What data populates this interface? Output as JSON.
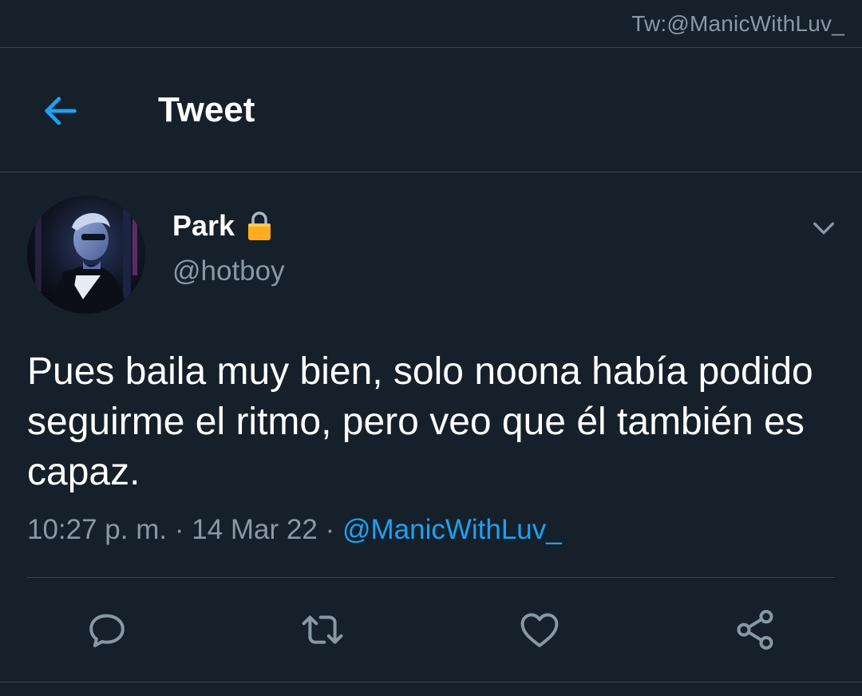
{
  "watermark": "Tw:@ManicWithLuv_",
  "header": {
    "title": "Tweet",
    "back_icon": "arrow-left-icon"
  },
  "author": {
    "display_name": "Park",
    "handle": "@hotboy",
    "protected_icon": "lock-icon"
  },
  "tweet": {
    "text": "Pues baila muy bien, solo noona había podido seguirme el ritmo, pero veo que él también es capaz.",
    "time": "10:27 p. m.",
    "sep1": "·",
    "date": "14 Mar 22",
    "sep2": "·",
    "via": "@ManicWithLuv_"
  },
  "actions": {
    "reply_icon": "reply-icon",
    "retweet_icon": "retweet-icon",
    "like_icon": "heart-icon",
    "share_icon": "share-icon"
  },
  "colors": {
    "background": "#15202b",
    "accent": "#1da1f2",
    "secondary_text": "#8899a6",
    "divider": "#38444d",
    "lock": "#ffad1f"
  }
}
